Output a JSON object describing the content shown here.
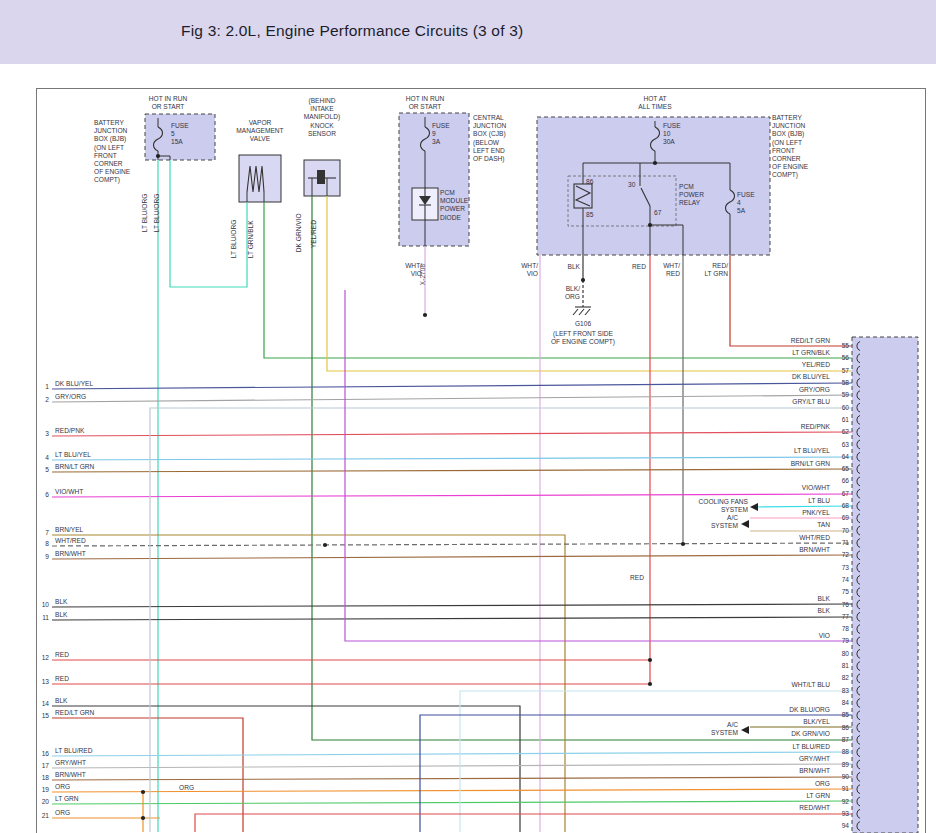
{
  "header": {
    "title": "Fig 3: 2.0L, Engine Performance Circuits (3 of 3)"
  },
  "ui": {
    "header_bg": "#d9d6ee",
    "box_fill": "#ccccee",
    "component_fill": "#d8d8f2",
    "wire_dark": "#333333"
  },
  "components": {
    "fuse5": {
      "power": "HOT IN RUN\nOR START",
      "fuse": "FUSE\n5\n15A",
      "box_label": "BATTERY\nJUNCTION\nBOX (BJB)\n(ON LEFT\nFRONT\nCORNER\nOF ENGINE\nCOMPT)"
    },
    "vmv": {
      "label": "VAPOR\nMANAGEMENT\nVALVE"
    },
    "knock": {
      "label": "(BEHIND\nINTAKE\nMANIFOLD)\nKNOCK\nSENSOR"
    },
    "cjb": {
      "power": "HOT IN RUN\nOR START",
      "fuse": "FUSE\n9\n3A",
      "diode": "PCM\nMODULE\nPOWER\nDIODE",
      "box_label": "CENTRAL\nJUNCTION\nBOX (CJB)\n(BELOW\nLEFT END\nOF DASH)"
    },
    "bjb2": {
      "power": "HOT AT\nALL TIMES",
      "fuse10": "FUSE\n10\n30A",
      "fuse4": "FUSE\n4\n5A",
      "relay": "PCM\nPOWER\nRELAY",
      "pin86": "86",
      "pin85": "85",
      "pin30": "30",
      "pin67": "67",
      "box_label": "BATTERY\nJUNCTION\nBOX (BJB)\n(ON LEFT\nFRONT\nCORNER\nOF ENGINE\nCOMPT)"
    }
  },
  "ground": {
    "id": "G106",
    "location": "(LEFT FRONT SIDE\nOF ENGINE COMPT)"
  },
  "annotations": {
    "cooling_fans": "COOLING FANS\nSYSTEM",
    "ac_upper": "A/C\nSYSTEM",
    "ac_lower": "A/C\nSYSTEM"
  },
  "wire_labels": {
    "vertical": {
      "lt_blu_org_a": "LT BLU/ORG",
      "lt_blu_org_b": "LT BLU/ORG",
      "lt_blu_org_c": "LT BLU/ORG",
      "lt_grn_blk": "LT GRN/BLK",
      "dk_grn_vio": "DK GRN/VIO",
      "yel_red": "YEL/RED",
      "x2708": "X-2708"
    },
    "drop": {
      "wht_vio_a": "WHT/\nVIO",
      "wht_vio_b": "WHT/\nVIO",
      "blk": "BLK",
      "red": "RED",
      "wht_red": "WHT/\nRED",
      "red_lt_grn": "RED/\nLT GRN",
      "blk_org": "BLK/\nORG",
      "red_mid": "RED",
      "org_mid": "ORG"
    }
  },
  "left_rows": [
    {
      "n": "1",
      "label": "DK BLU/YEL"
    },
    {
      "n": "2",
      "label": "GRY/ORG"
    },
    {
      "n": "3",
      "label": "RED/PNK"
    },
    {
      "n": "4",
      "label": "LT BLU/YEL"
    },
    {
      "n": "5",
      "label": "BRN/LT GRN"
    },
    {
      "n": "6",
      "label": "VIO/WHT"
    },
    {
      "n": "7",
      "label": "BRN/YEL"
    },
    {
      "n": "8",
      "label": "WHT/RED"
    },
    {
      "n": "9",
      "label": "BRN/WHT"
    },
    {
      "n": "10",
      "label": "BLK"
    },
    {
      "n": "11",
      "label": "BLK"
    },
    {
      "n": "12",
      "label": "RED"
    },
    {
      "n": "13",
      "label": "RED"
    },
    {
      "n": "14",
      "label": "BLK"
    },
    {
      "n": "15",
      "label": "RED/LT GRN"
    },
    {
      "n": "16",
      "label": "LT BLU/RED"
    },
    {
      "n": "17",
      "label": "GRY/WHT"
    },
    {
      "n": "18",
      "label": "BRN/WHT"
    },
    {
      "n": "19",
      "label": "ORG"
    },
    {
      "n": "20",
      "label": "LT GRN"
    },
    {
      "n": "21",
      "label": "ORG"
    }
  ],
  "right_pins": [
    {
      "n": "55",
      "label": "RED/LT GRN"
    },
    {
      "n": "56",
      "label": "LT GRN/BLK"
    },
    {
      "n": "57",
      "label": "YEL/RED"
    },
    {
      "n": "58",
      "label": "DK BLU/YEL"
    },
    {
      "n": "59",
      "label": "GRY/ORG"
    },
    {
      "n": "60",
      "label": "GRY/LT BLU"
    },
    {
      "n": "61",
      "label": ""
    },
    {
      "n": "62",
      "label": "RED/PNK"
    },
    {
      "n": "63",
      "label": ""
    },
    {
      "n": "64",
      "label": "LT BLU/YEL"
    },
    {
      "n": "65",
      "label": "BRN/LT GRN"
    },
    {
      "n": "66",
      "label": ""
    },
    {
      "n": "67",
      "label": "VIO/WHT"
    },
    {
      "n": "68",
      "label": "LT BLU"
    },
    {
      "n": "69",
      "label": "PNK/YEL"
    },
    {
      "n": "70",
      "label": "TAN"
    },
    {
      "n": "71",
      "label": "WHT/RED"
    },
    {
      "n": "72",
      "label": "BRN/WHT"
    },
    {
      "n": "73",
      "label": ""
    },
    {
      "n": "74",
      "label": ""
    },
    {
      "n": "75",
      "label": ""
    },
    {
      "n": "76",
      "label": "BLK"
    },
    {
      "n": "77",
      "label": "BLK"
    },
    {
      "n": "78",
      "label": ""
    },
    {
      "n": "79",
      "label": "VIO"
    },
    {
      "n": "80",
      "label": ""
    },
    {
      "n": "81",
      "label": ""
    },
    {
      "n": "82",
      "label": ""
    },
    {
      "n": "83",
      "label": "WHT/LT BLU"
    },
    {
      "n": "84",
      "label": ""
    },
    {
      "n": "85",
      "label": "DK BLU/ORG"
    },
    {
      "n": "86",
      "label": "BLK/YEL"
    },
    {
      "n": "87",
      "label": "DK GRN/VIO"
    },
    {
      "n": "88",
      "label": "LT BLU/RED"
    },
    {
      "n": "89",
      "label": "GRY/WHT"
    },
    {
      "n": "90",
      "label": "BRN/WHT"
    },
    {
      "n": "91",
      "label": "ORG"
    },
    {
      "n": "92",
      "label": "LT GRN"
    },
    {
      "n": "93",
      "label": "RED/WHT"
    },
    {
      "n": "94",
      "label": ""
    }
  ],
  "colors": {
    "LT BLU/ORG": "#3fd9b8",
    "LT GRN/BLK": "#38a348",
    "DK GRN/VIO": "#2e7d36",
    "YEL/RED": "#e2c63e",
    "WHT/VIO": "#dcaee4",
    "BLK": "#3a3a3a",
    "RED": "#e04848",
    "WHT/RED": "#6a6a6a",
    "RED/LT GRN": "#c0392b",
    "DK BLU/YEL": "#4a569a",
    "GRY/ORG": "#a2a2a2",
    "GRY/LT BLU": "#bccad4",
    "RED/PNK": "#e2505e",
    "LT BLU/YEL": "#79c6e8",
    "BRN/LT GRN": "#9a6a34",
    "VIO/WHT": "#ea3fd2",
    "LT BLU": "#35dde8",
    "PNK/YEL": "#ff9cc0",
    "TAN": "#d2b48c",
    "BRN/YEL": "#a8862c",
    "BRN/WHT": "#9c6b42",
    "VIO": "#bb50d8",
    "WHT/LT BLU": "#c6e4f2",
    "DK BLU/ORG": "#3e4e9e",
    "BLK/YEL": "#7a6a20",
    "LT BLU/RED": "#8cd0ea",
    "GRY/WHT": "#b6b6b6",
    "ORG": "#f0912e",
    "LT GRN": "#4ec966",
    "RED/WHT": "#e04848"
  }
}
